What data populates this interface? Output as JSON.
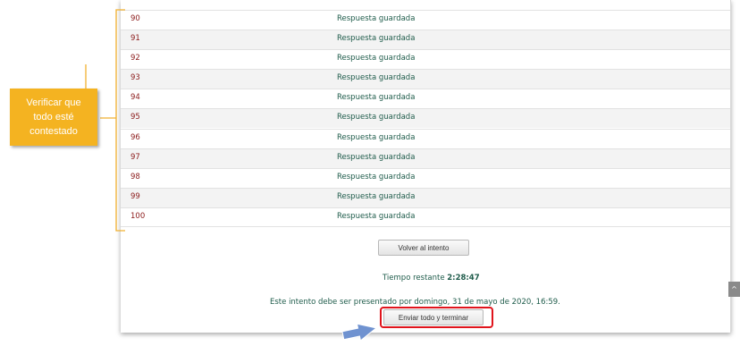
{
  "summary": {
    "rows": [
      {
        "number": "90",
        "status": "Respuesta guardada"
      },
      {
        "number": "91",
        "status": "Respuesta guardada"
      },
      {
        "number": "92",
        "status": "Respuesta guardada"
      },
      {
        "number": "93",
        "status": "Respuesta guardada"
      },
      {
        "number": "94",
        "status": "Respuesta guardada"
      },
      {
        "number": "95",
        "status": "Respuesta guardada"
      },
      {
        "number": "96",
        "status": "Respuesta guardada"
      },
      {
        "number": "97",
        "status": "Respuesta guardada"
      },
      {
        "number": "98",
        "status": "Respuesta guardada"
      },
      {
        "number": "99",
        "status": "Respuesta guardada"
      },
      {
        "number": "100",
        "status": "Respuesta guardada"
      }
    ]
  },
  "actions": {
    "back_label": "Volver al intento",
    "submit_label": "Enviar todo y terminar"
  },
  "timer": {
    "label": "Tiempo restante",
    "value": "2:28:47"
  },
  "deadline_text": "Este intento debe ser presentado por domingo, 31 de mayo de 2020, 16:59.",
  "annotation": {
    "line1": "Verificar que",
    "line2": "todo esté",
    "line3": "contestado"
  },
  "icons": {
    "scroll_top": "chevron-up-icon",
    "pointer": "arrow-icon"
  },
  "colors": {
    "question_number": "#8b1a1a",
    "status_text": "#1f5c4b",
    "callout": "#f4b321",
    "bracket": "#f0b030",
    "highlight": "#e0141c",
    "arrow": "#6f92d0"
  }
}
